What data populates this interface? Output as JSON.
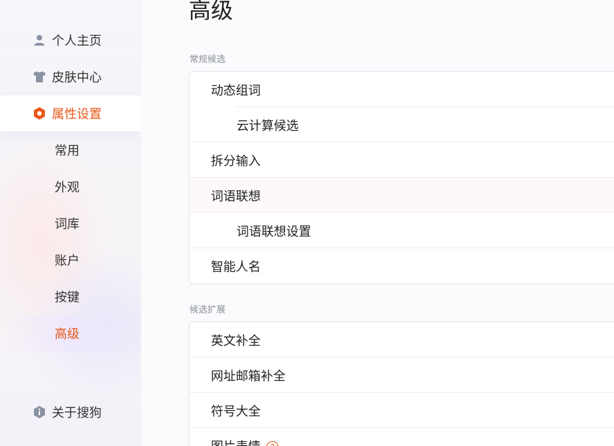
{
  "sidebar": {
    "items": [
      {
        "label": "个人主页",
        "icon": "user-icon"
      },
      {
        "label": "皮肤中心",
        "icon": "shirt-icon"
      },
      {
        "label": "属性设置",
        "icon": "hexagon-settings-icon"
      }
    ],
    "sub_items": [
      "常用",
      "外观",
      "词库",
      "账户",
      "按键",
      "高级"
    ],
    "selected_sub": "高级",
    "about": {
      "label": "关于搜狗",
      "icon": "info-hexagon-icon"
    }
  },
  "main": {
    "title": "高级",
    "sections": [
      {
        "label": "常规候选",
        "rows": [
          "动态组词",
          "云计算候选",
          "拆分输入",
          "词语联想",
          "词语联想设置",
          "智能人名"
        ]
      },
      {
        "label": "候选扩展",
        "rows": [
          "英文补全",
          "网址邮箱补全",
          "符号大全",
          "图片表情"
        ],
        "help_icon": "?"
      }
    ]
  },
  "colors": {
    "accent": "#e8571a",
    "icon_gray": "#8a93a3",
    "sidebar_bg": "#f5f5fa",
    "card_border": "#e3e3e8"
  }
}
